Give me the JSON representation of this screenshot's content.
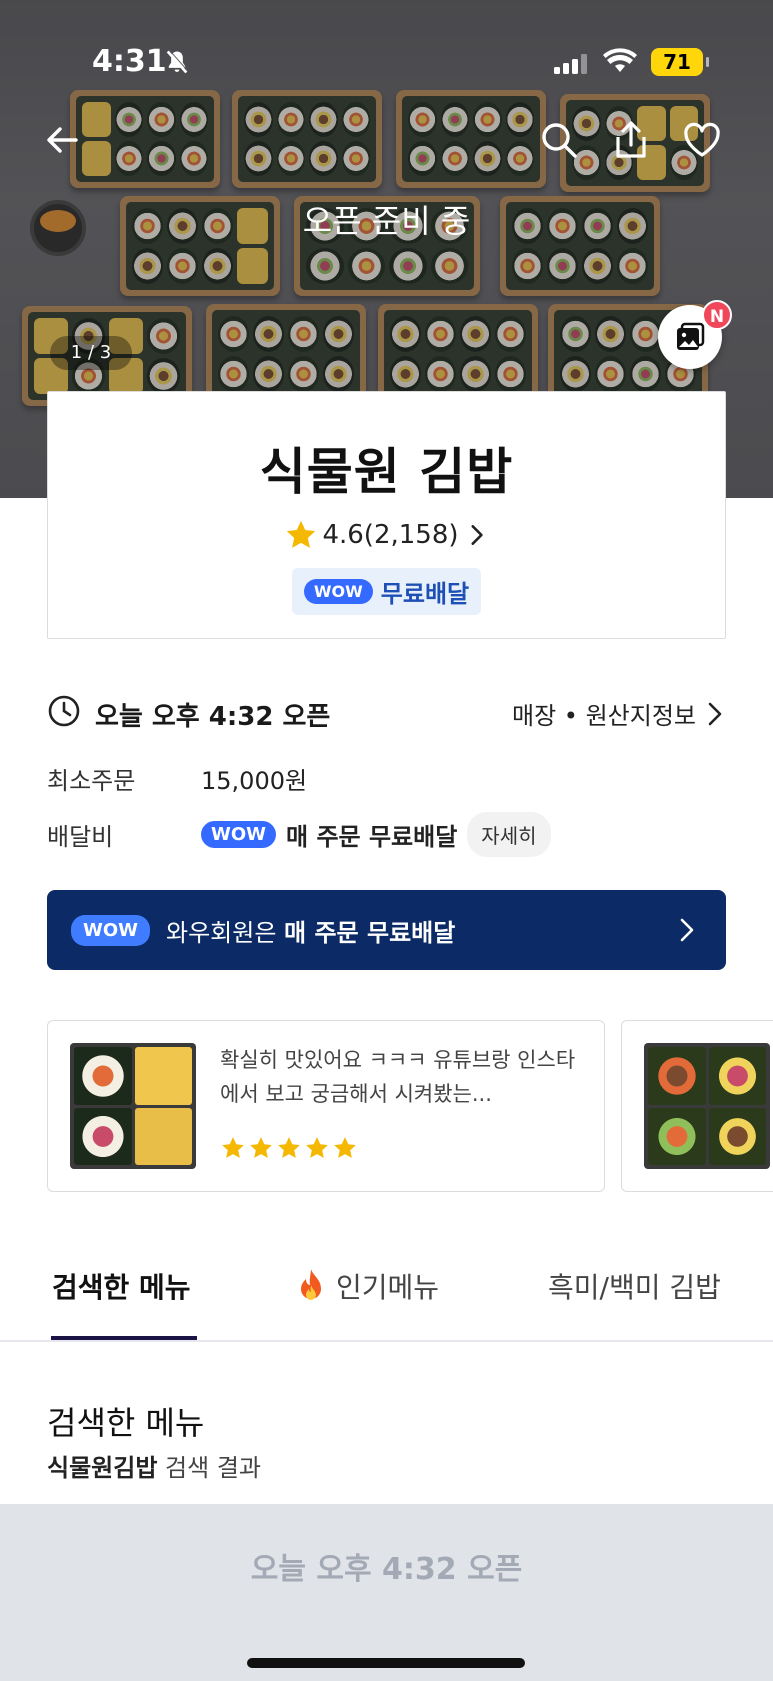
{
  "status_bar": {
    "time": "4:31",
    "battery": "71"
  },
  "hero": {
    "status_text": "오픈 준비 중",
    "image_counter": "1 / 3",
    "photo_badge": "N"
  },
  "store": {
    "name": "식물원 김밥",
    "rating": "4.6(2,158)",
    "wow_label": "WOW",
    "free_delivery_badge": "무료배달"
  },
  "info": {
    "open_time": "오늘 오후 4:32 오픈",
    "store_info_link": "매장 • 원산지정보",
    "min_order_label": "최소주문",
    "min_order_value": "15,000원",
    "delivery_fee_label": "배달비",
    "delivery_fee_wow": "WOW",
    "delivery_fee_value": "매 주문 무료배달",
    "detail_button": "자세히"
  },
  "wow_banner": {
    "pill": "WOW",
    "text_prefix": "와우회원은 ",
    "text_bold": "매 주문 무료배달"
  },
  "reviews": [
    {
      "text": "확실히 맛있어요 ㅋㅋㅋ 유튜브랑 인스타에서 보고 궁금해서 시켜봤는...",
      "stars": 5
    }
  ],
  "tabs": [
    {
      "label": "검색한 메뉴",
      "active": true
    },
    {
      "label": "인기메뉴",
      "active": false
    },
    {
      "label": "흑미/백미 김밥",
      "active": false
    }
  ],
  "section": {
    "title": "검색한 메뉴",
    "search_keyword": "식물원김밥",
    "search_suffix": " 검색 결과"
  },
  "bottom_bar": {
    "open_text": "오늘 오후 4:32 오픈"
  },
  "colors": {
    "wow_blue": "#346aff",
    "banner_navy": "#0c2b66",
    "star_yellow": "#f5b800",
    "tab_underline": "#1a1446"
  }
}
